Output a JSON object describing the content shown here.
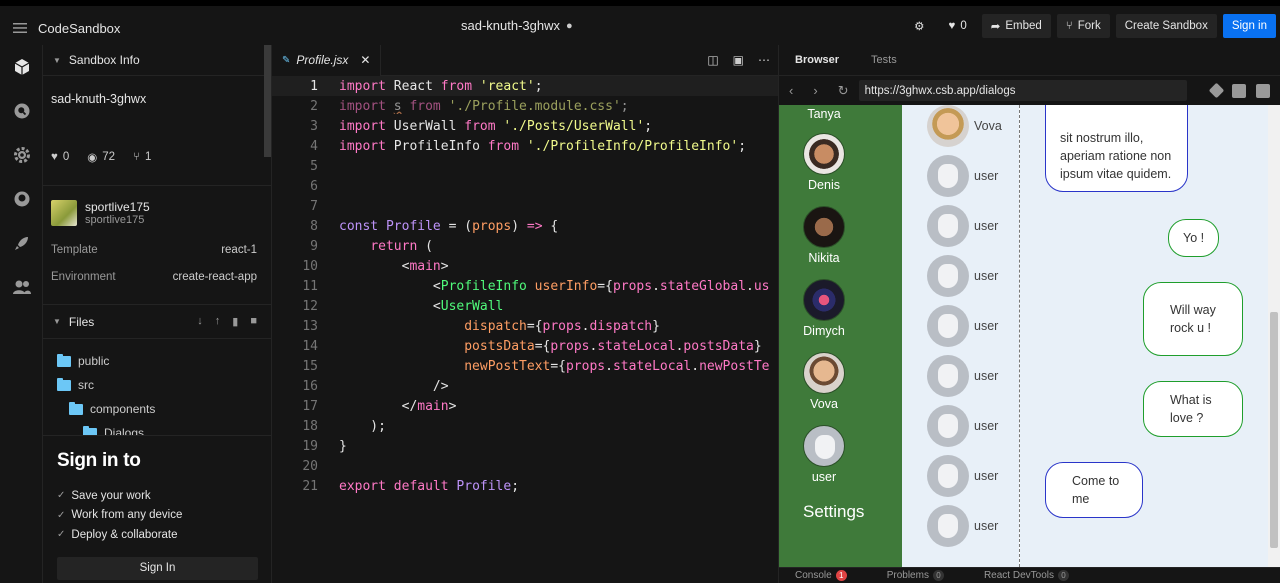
{
  "topbar": {
    "brand": "CodeSandbox",
    "sandbox_name": "sad-knuth-3ghwx",
    "likes": "0",
    "embed": "Embed",
    "fork": "Fork",
    "create": "Create Sandbox",
    "signin": "Sign in"
  },
  "sidebar": {
    "section_title": "Sandbox Info",
    "name": "sad-knuth-3ghwx",
    "stats": {
      "likes": "0",
      "views": "72",
      "forks": "1"
    },
    "owner": {
      "name": "sportlive175",
      "handle": "sportlive175"
    },
    "template_label": "Template",
    "template_value": "react-1",
    "env_label": "Environment",
    "env_value": "create-react-app",
    "files_title": "Files",
    "tree": [
      "public",
      "src",
      "components",
      "Dialogs"
    ],
    "signin": {
      "title": "Sign in to",
      "items": [
        "Save your work",
        "Work from any device",
        "Deploy & collaborate"
      ],
      "button": "Sign In"
    }
  },
  "editor": {
    "tab": "Profile.jsx",
    "lines": [
      {
        "n": "1",
        "t": "import React from 'react';"
      },
      {
        "n": "2",
        "t": "import s from './Profile.module.css';"
      },
      {
        "n": "3",
        "t": "import UserWall from './Posts/UserWall';"
      },
      {
        "n": "4",
        "t": "import ProfileInfo from './ProfileInfo/ProfileInfo';"
      },
      {
        "n": "5",
        "t": ""
      },
      {
        "n": "6",
        "t": ""
      },
      {
        "n": "7",
        "t": ""
      },
      {
        "n": "8",
        "t": "const Profile = (props) => {"
      },
      {
        "n": "9",
        "t": "    return ("
      },
      {
        "n": "10",
        "t": "        <main>"
      },
      {
        "n": "11",
        "t": "            <ProfileInfo userInfo={props.stateGlobal.us"
      },
      {
        "n": "12",
        "t": "            <UserWall"
      },
      {
        "n": "13",
        "t": "                dispatch={props.dispatch}"
      },
      {
        "n": "14",
        "t": "                postsData={props.stateLocal.postsData}"
      },
      {
        "n": "15",
        "t": "                newPostText={props.stateLocal.newPostTe"
      },
      {
        "n": "16",
        "t": "            />"
      },
      {
        "n": "17",
        "t": "        </main>"
      },
      {
        "n": "18",
        "t": "    );"
      },
      {
        "n": "19",
        "t": "}"
      },
      {
        "n": "20",
        "t": ""
      },
      {
        "n": "21",
        "t": "export default Profile;"
      }
    ]
  },
  "browser": {
    "tab_browser": "Browser",
    "tab_tests": "Tests",
    "url": "https://3ghwx.csb.app/dialogs",
    "friends": [
      "Tanya",
      "Denis",
      "Nikita",
      "Dimych",
      "Vova",
      "user"
    ],
    "settings": "Settings",
    "dialogs": [
      "Vova",
      "user",
      "user",
      "user",
      "user",
      "user",
      "user",
      "user",
      "user"
    ],
    "messages": [
      {
        "text": "sit nostrum illo, aperiam ratione non ipsum vitae quidem."
      },
      {
        "text": "Yo !"
      },
      {
        "text": "Will way rock u !"
      },
      {
        "text": "What is love ?"
      },
      {
        "text": "Come to me"
      }
    ],
    "status": {
      "console": "Console",
      "console_count": "1",
      "problems": "Problems",
      "problems_count": "0",
      "devtools": "React DevTools",
      "devtools_count": "0"
    }
  }
}
